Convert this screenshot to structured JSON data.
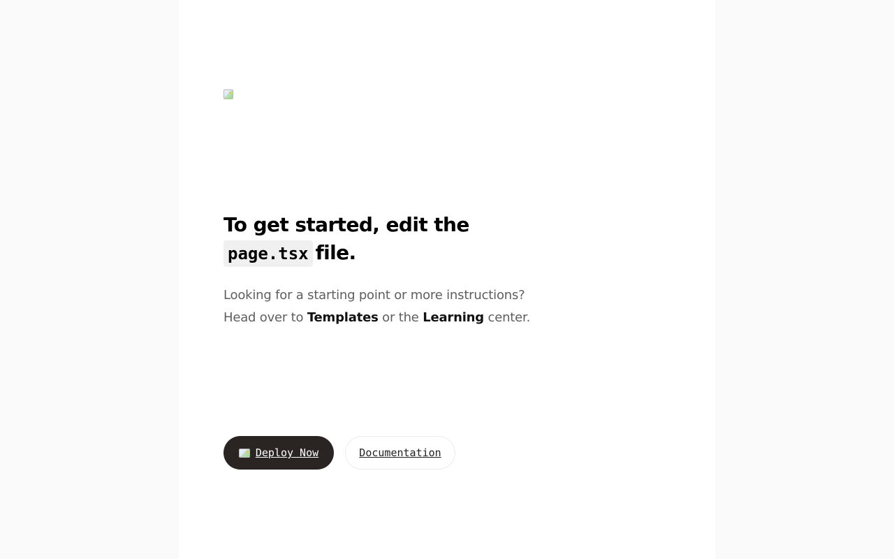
{
  "logo": {
    "icon": "broken-image-icon"
  },
  "hero": {
    "headline_prefix": "To get started, edit the",
    "code_file": "page.tsx",
    "headline_suffix": "file."
  },
  "intro": {
    "line1": "Looking for a starting point or more instructions?",
    "line2_prefix": "Head over to",
    "templates_link": "Templates",
    "or_the": "or the",
    "learning_link": "Learning",
    "center": "center."
  },
  "actions": {
    "deploy_label": "Deploy Now",
    "deploy_icon": "deploy-logo-icon",
    "docs_label": "Documentation"
  },
  "colors": {
    "page_bg": "#fafafa",
    "content_bg": "#ffffff",
    "primary_button": "#2a2523",
    "muted_text": "#5e5e5e"
  }
}
